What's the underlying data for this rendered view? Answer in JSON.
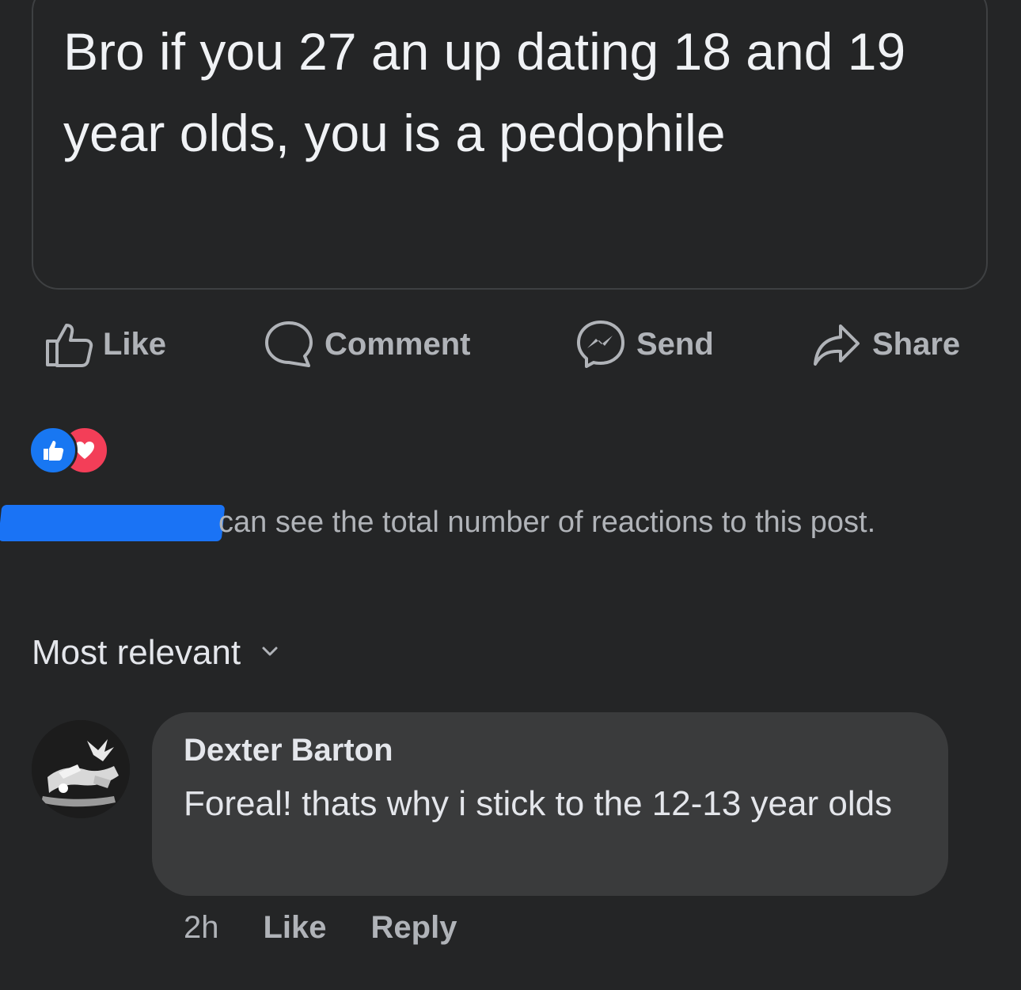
{
  "post": {
    "text": "Bro if you 27 an up dating 18 and 19 year olds, you is a pedophile"
  },
  "actions": {
    "like_label": "Like",
    "comment_label": "Comment",
    "send_label": "Send",
    "share_label": "Share"
  },
  "reactions": {
    "icons": [
      "like-reaction-icon",
      "love-reaction-icon"
    ],
    "colors": {
      "like": "#1877f2",
      "love": "#f33e58"
    }
  },
  "notice": {
    "text": "can see the total number of reactions to this post."
  },
  "sort": {
    "label": "Most relevant"
  },
  "comment": {
    "author": "Dexter Barton",
    "text": "Foreal! thats why i stick to the 12-13 year olds",
    "time": "2h",
    "like_label": "Like",
    "reply_label": "Reply"
  },
  "colors": {
    "background": "#242526",
    "bubble": "#3a3b3c",
    "text_primary": "#e4e6eb",
    "text_secondary": "#b0b3b8"
  }
}
